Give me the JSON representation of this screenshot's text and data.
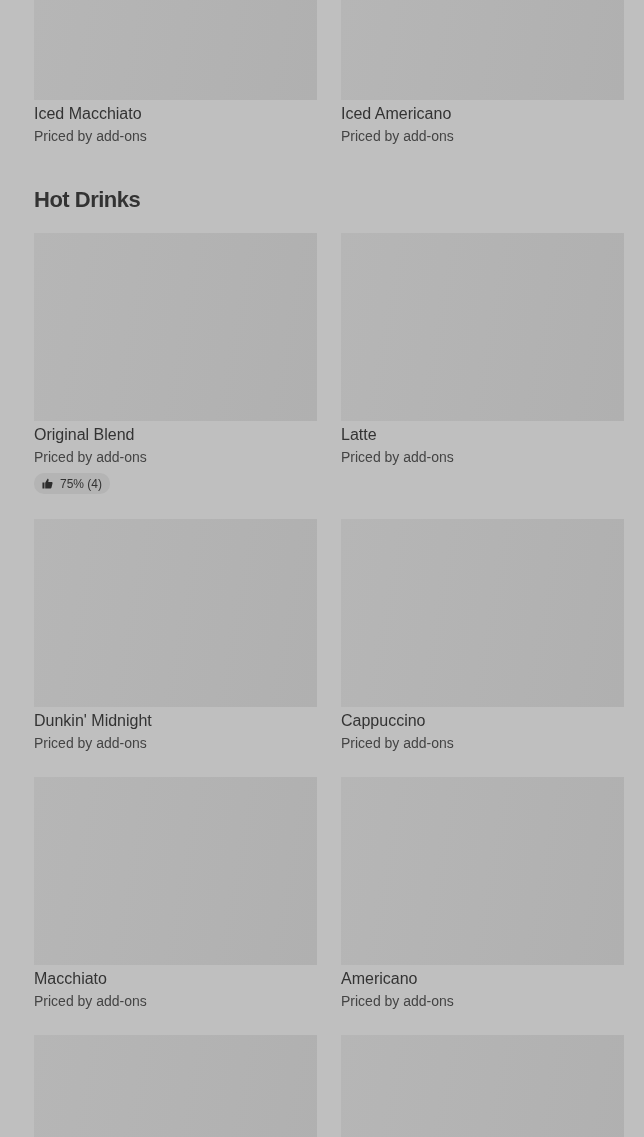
{
  "sections": [
    {
      "items": [
        {
          "kind": "product",
          "name": "Iced Macchiato",
          "price": "Priced by add-ons"
        },
        {
          "kind": "product",
          "name": "Iced Americano",
          "price": "Priced by add-ons"
        }
      ]
    },
    {
      "title": "Hot Drinks",
      "items": [
        {
          "kind": "product",
          "name": "Original Blend",
          "price": "Priced by add-ons",
          "rating": "75% (4)"
        },
        {
          "kind": "product",
          "name": "Latte",
          "price": "Priced by add-ons"
        },
        {
          "kind": "product",
          "name": "Dunkin' Midnight",
          "price": "Priced by add-ons"
        },
        {
          "kind": "product",
          "name": "Cappuccino",
          "price": "Priced by add-ons"
        },
        {
          "kind": "product",
          "name": "Macchiato",
          "price": "Priced by add-ons"
        },
        {
          "kind": "product",
          "name": "Americano",
          "price": "Priced by add-ons"
        },
        {
          "kind": "image-only"
        },
        {
          "kind": "image-only"
        }
      ]
    }
  ]
}
